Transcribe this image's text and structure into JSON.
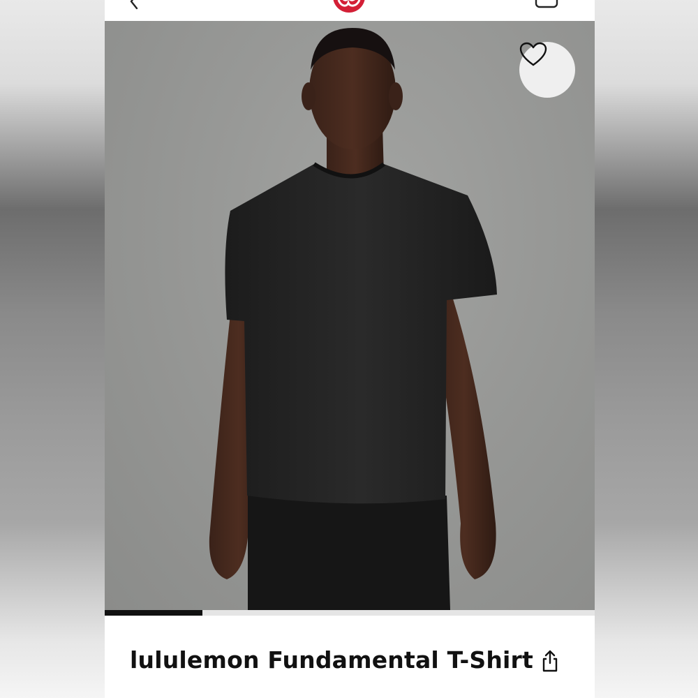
{
  "product": {
    "title": "lululemon Fundamental T-Shirt"
  },
  "gallery": {
    "progress_fraction": 0.2
  },
  "icons": {
    "back": "chevron-left-icon",
    "logo": "lululemon-logo",
    "bag": "shopping-bag-icon",
    "wishlist": "heart-icon",
    "share": "share-icon"
  },
  "colors": {
    "brand": "#d31f36",
    "text": "#111111",
    "wish_button_bg": "#efefef"
  }
}
